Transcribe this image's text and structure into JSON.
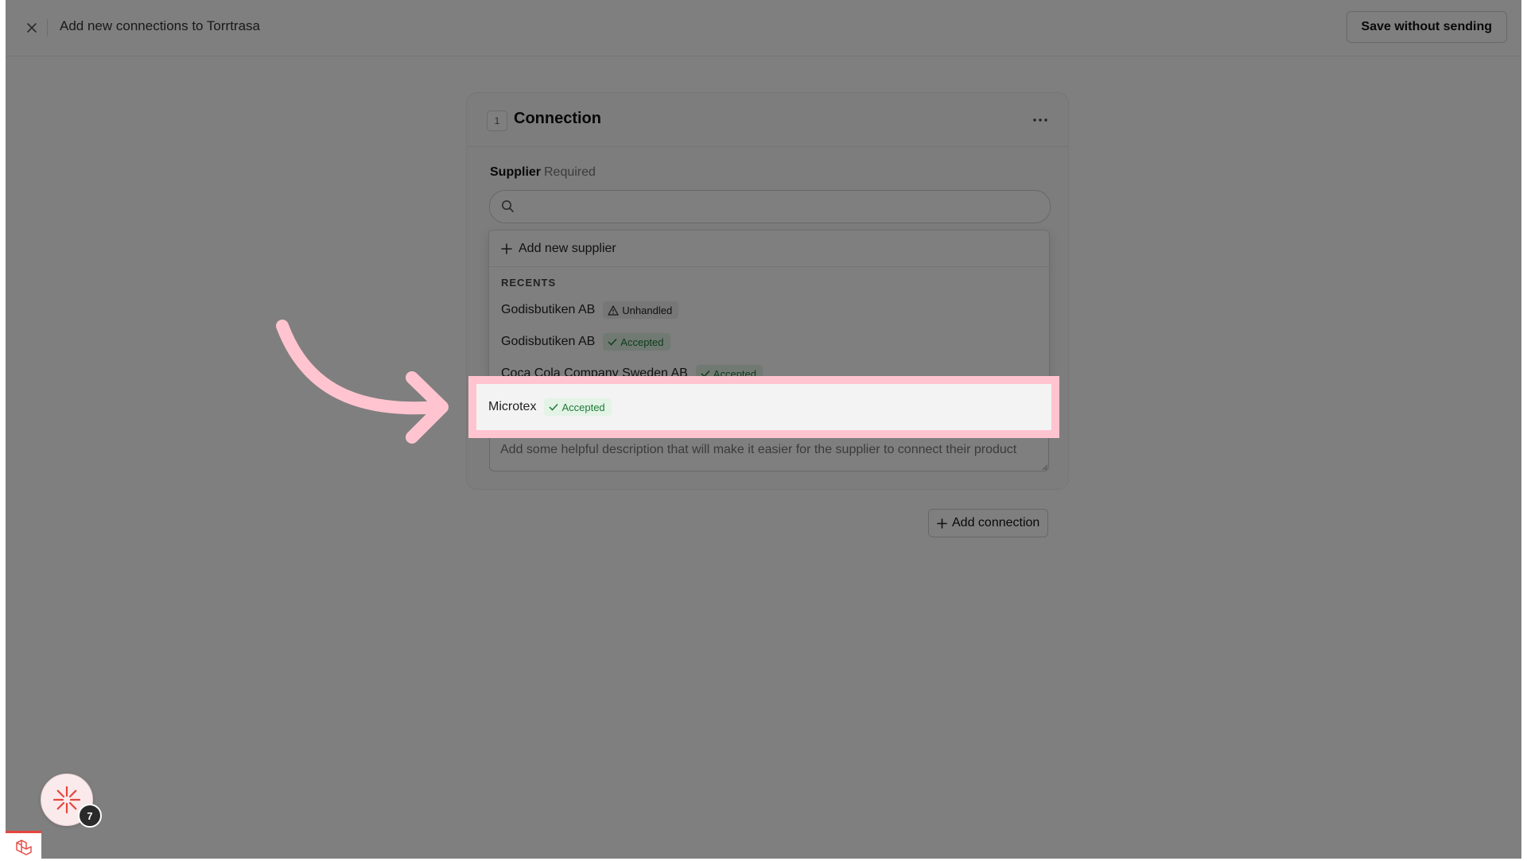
{
  "header": {
    "title": "Add new connections to Torrtrasa",
    "save_label": "Save without sending"
  },
  "card": {
    "number": "1",
    "title": "Connection",
    "supplier_label": "Supplier",
    "required_label": "Required",
    "search_placeholder": "",
    "description_placeholder": "Add some helpful description that will make it easier for the supplier to connect their product"
  },
  "dropdown": {
    "add_label": "Add new supplier",
    "section_title": "RECENTS",
    "items": [
      {
        "name": "Godisbutiken AB",
        "status": "Unhandled",
        "status_icon": "warning-triangle-icon"
      },
      {
        "name": "Godisbutiken AB",
        "status": "Accepted",
        "status_icon": "check-icon"
      },
      {
        "name": "Coca Cola Company Sweden AB",
        "status": "Accepted",
        "status_icon": "check-icon"
      },
      {
        "name": "Microtex",
        "status": "Accepted",
        "status_icon": "check-icon"
      }
    ]
  },
  "add_connection_label": "Add connection",
  "assistant": {
    "count": "7",
    "icon": "sparkle-icon"
  },
  "colors": {
    "highlight_border": "#ffc4cf",
    "arrow": "#ffc4cf",
    "accepted_bg": "#e3f3e6",
    "accepted_text": "#1f7a37",
    "debug_accent": "#e4473f"
  }
}
